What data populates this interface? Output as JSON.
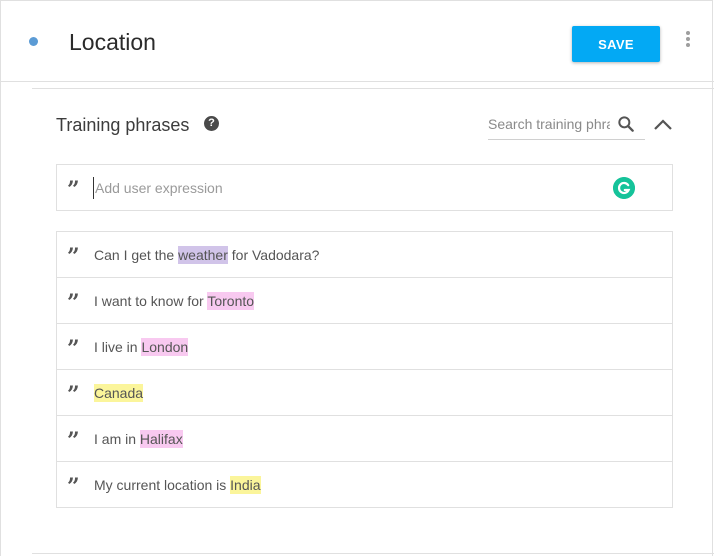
{
  "header": {
    "title": "Location",
    "save_label": "SAVE",
    "status_color": "#5b9bd5"
  },
  "training": {
    "title": "Training phrases",
    "help_icon": "?",
    "search_placeholder": "Search training phrases",
    "add_placeholder": "Add user expression",
    "phrases": [
      {
        "before": "Can I get the ",
        "entity": "weather",
        "after": " for Vadodara?",
        "color": "#d1c4e9"
      },
      {
        "before": "I want to know for ",
        "entity": "Toronto",
        "after": "",
        "color": "#f8c9f0"
      },
      {
        "before": "I live in ",
        "entity": "London",
        "after": "",
        "color": "#f8c9f0"
      },
      {
        "before": "",
        "entity": "Canada",
        "after": "",
        "color": "#fbf59b"
      },
      {
        "before": "I am in ",
        "entity": "Halifax",
        "after": "",
        "color": "#f8c9f0"
      },
      {
        "before": "My current location is ",
        "entity": "India",
        "after": "",
        "color": "#fbf59b"
      }
    ]
  },
  "icons": {
    "status": "status-dot",
    "more": "more-vert-icon",
    "help": "help-circle-icon",
    "search": "search-icon",
    "collapse": "chevron-up-icon",
    "quote": "quote-icon",
    "grammarly": "grammarly-icon"
  },
  "colors": {
    "accent": "#03a9f4",
    "grammarly": "#15c39a"
  }
}
